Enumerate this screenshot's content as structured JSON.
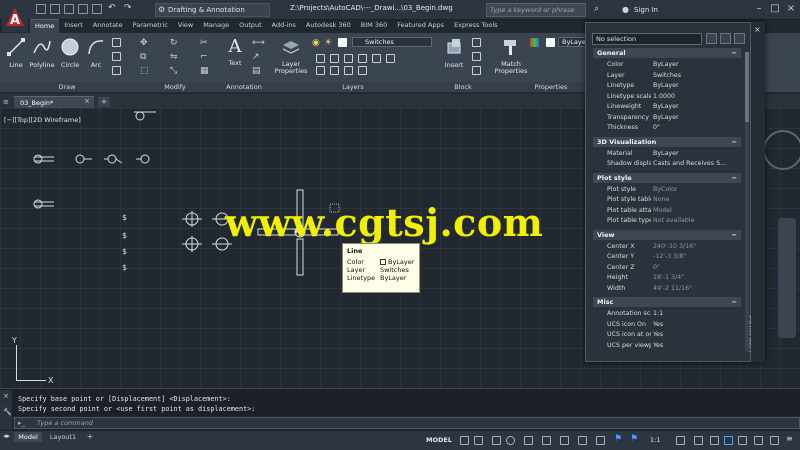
{
  "title_bar": {
    "workspace": "Drafting & Annotation",
    "file_path": "Z:\\Projects\\AutoCAD\\---_Drawi...\\03_Begin.dwg",
    "search_placeholder": "Type a keyword or phrase",
    "sign_in": "Sign In"
  },
  "ribbon": {
    "tabs": [
      "Home",
      "Insert",
      "Annotate",
      "Parametric",
      "View",
      "Manage",
      "Output",
      "Add-ins",
      "Autodesk 360",
      "BIM 360",
      "Featured Apps",
      "Express Tools"
    ],
    "tools": {
      "line": "Line",
      "polyline": "Polyline",
      "circle": "Circle",
      "arc": "Arc",
      "text": "Text",
      "layer_properties": "Layer Properties",
      "insert": "Insert",
      "match_properties": "Match Properties"
    },
    "panels": {
      "draw": "Draw",
      "modify": "Modify",
      "annotation": "Annotation",
      "layers": "Layers",
      "block": "Block",
      "properties": "Properties"
    },
    "layer_current": "Switches",
    "color_current": "ByLayer"
  },
  "file_tab": {
    "name": "03_Begin*"
  },
  "viewport": {
    "label": "[−][Top][2D Wireframe]"
  },
  "watermark": "www.cgtsj.com",
  "tooltip": {
    "title": "Line",
    "rows": [
      {
        "k": "Color",
        "v": "ByLayer"
      },
      {
        "k": "Layer",
        "v": "Switches"
      },
      {
        "k": "Linetype",
        "v": "ByLayer"
      }
    ]
  },
  "properties": {
    "palette_title": "PROPERTIES",
    "selection": "No selection",
    "sections": [
      {
        "name": "General",
        "rows": [
          {
            "k": "Color",
            "v": "ByLayer"
          },
          {
            "k": "Layer",
            "v": "Switches"
          },
          {
            "k": "Linetype",
            "v": "ByLayer"
          },
          {
            "k": "Linetype scale",
            "v": "1.0000"
          },
          {
            "k": "Lineweight",
            "v": "ByLayer"
          },
          {
            "k": "Transparency",
            "v": "ByLayer"
          },
          {
            "k": "Thickness",
            "v": "0\""
          }
        ]
      },
      {
        "name": "3D Visualization",
        "rows": [
          {
            "k": "Material",
            "v": "ByLayer"
          },
          {
            "k": "Shadow display",
            "v": "Casts and Receives S..."
          }
        ]
      },
      {
        "name": "Plot style",
        "rows": [
          {
            "k": "Plot style",
            "v": "ByColor"
          },
          {
            "k": "Plot style table",
            "v": "None"
          },
          {
            "k": "Plot table attac...",
            "v": "Model"
          },
          {
            "k": "Plot table type",
            "v": "Not available"
          }
        ]
      },
      {
        "name": "View",
        "rows": [
          {
            "k": "Center X",
            "v": "240'-10 3/16\""
          },
          {
            "k": "Center Y",
            "v": "-12'-3 3/8\""
          },
          {
            "k": "Center Z",
            "v": "0\""
          },
          {
            "k": "Height",
            "v": "18'-1 3/4\""
          },
          {
            "k": "Width",
            "v": "49'-2 11/16\""
          }
        ]
      },
      {
        "name": "Misc",
        "rows": [
          {
            "k": "Annotation scale",
            "v": "1:1"
          },
          {
            "k": "UCS icon On",
            "v": "Yes"
          },
          {
            "k": "UCS icon at ori...",
            "v": "Yes"
          },
          {
            "k": "UCS per viewport",
            "v": "Yes"
          }
        ]
      }
    ]
  },
  "command": {
    "history": [
      "Specify base point or [Displacement] <Displacement>:",
      "Specify second point or <use first point as displacement>:"
    ],
    "placeholder": "Type a command"
  },
  "status": {
    "model_tab": "Model",
    "layout_tab": "Layout1",
    "model_button": "MODEL",
    "scale": "1:1"
  },
  "ucs": {
    "x": "X",
    "y": "Y"
  },
  "colors": {
    "accent": "#c8202a",
    "watermark": "#f0f000",
    "canvas": "#212830",
    "ribbon": "#3b4451"
  }
}
